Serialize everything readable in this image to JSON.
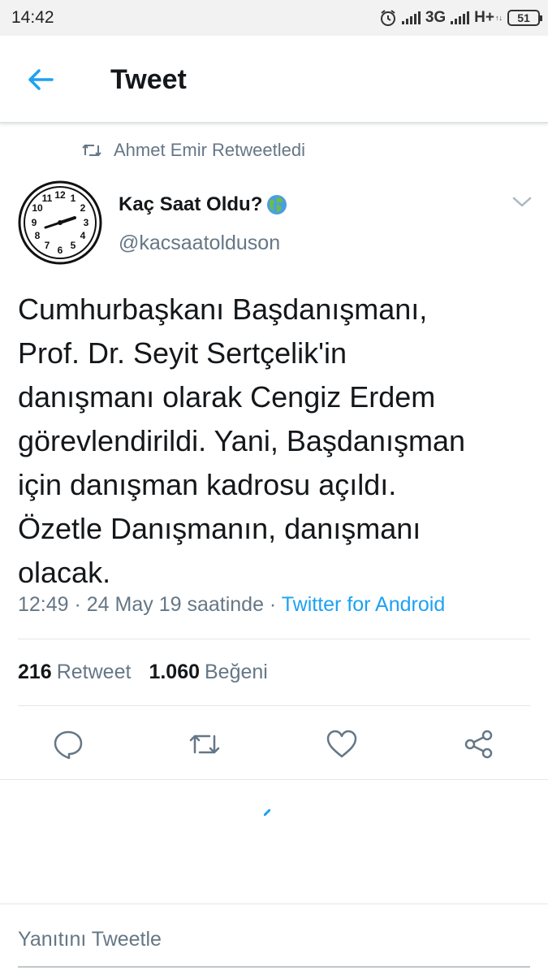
{
  "status_bar": {
    "time": "14:42",
    "network_1": "3G",
    "network_2": "H+",
    "battery": "51"
  },
  "app_bar": {
    "title": "Tweet"
  },
  "retweet_context": {
    "text": "Ahmet Emir Retweetledi"
  },
  "author": {
    "display_name": "Kaç Saat Oldu?",
    "handle": "@kacsaatolduson"
  },
  "tweet": {
    "text": "Cumhurbaşkanı Başdanışmanı,\nProf. Dr. Seyit Sertçelik'in\ndanışmanı olarak Cengiz Erdem\ngörevlendirildi. Yani, Başdanışman\niçin danışman kadrosu açıldı.\nÖzetle Danışmanın, danışmanı\nolacak.",
    "timestamp": "12:49 · 24 May 19 saatinde · ",
    "source": "Twitter for Android"
  },
  "stats": {
    "retweet_count": "216",
    "retweet_label": "Retweet",
    "like_count": "1.060",
    "like_label": "Beğeni"
  },
  "actions": [
    "reply-icon",
    "retweet-icon",
    "like-icon",
    "share-icon"
  ],
  "reply_composer": {
    "placeholder": "Yanıtını Tweetle"
  },
  "colors": {
    "accent": "#1da1f2",
    "secondary_text": "#657786",
    "primary_text": "#14171a",
    "divider": "#e1e8ed"
  }
}
